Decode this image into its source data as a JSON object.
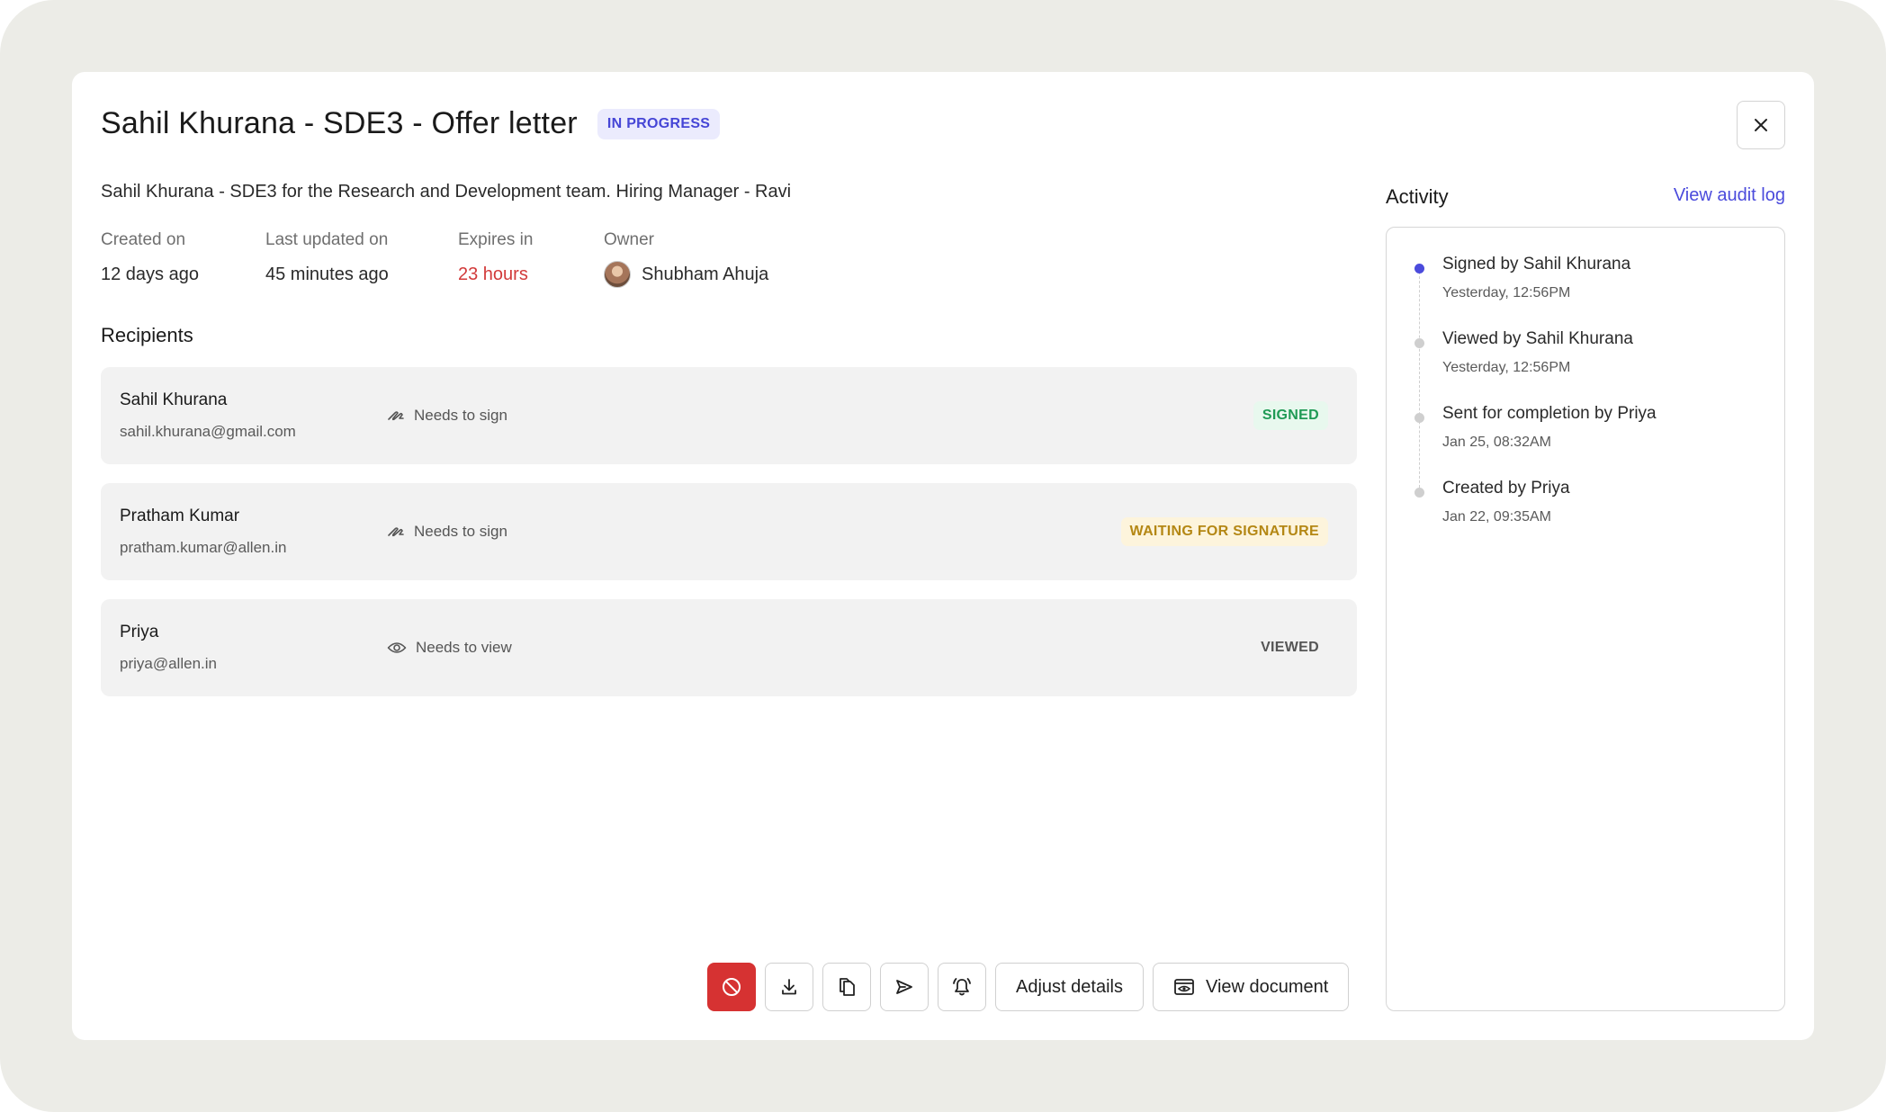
{
  "header": {
    "title": "Sahil Khurana - SDE3 - Offer letter",
    "status": "IN PROGRESS",
    "description": "Sahil Khurana - SDE3 for the Research and Development team. Hiring Manager - Ravi"
  },
  "meta": {
    "created_label": "Created on",
    "created_value": "12 days ago",
    "updated_label": "Last updated on",
    "updated_value": "45 minutes ago",
    "expires_label": "Expires in",
    "expires_value": "23 hours",
    "owner_label": "Owner",
    "owner_value": "Shubham Ahuja"
  },
  "recipients": {
    "title": "Recipients",
    "items": [
      {
        "name": "Sahil Khurana",
        "email": "sahil.khurana@gmail.com",
        "role": "Needs to sign",
        "role_icon": "signature-icon",
        "status": "SIGNED"
      },
      {
        "name": "Pratham Kumar",
        "email": "pratham.kumar@allen.in",
        "role": "Needs to sign",
        "role_icon": "signature-icon",
        "status": "WAITING FOR SIGNATURE"
      },
      {
        "name": "Priya",
        "email": "priya@allen.in",
        "role": "Needs to view",
        "role_icon": "eye-icon",
        "status": "VIEWED"
      }
    ]
  },
  "activity": {
    "title": "Activity",
    "audit_link": "View audit log",
    "items": [
      {
        "text": "Signed by Sahil Khurana",
        "time": "Yesterday, 12:56PM"
      },
      {
        "text": "Viewed by Sahil Khurana",
        "time": "Yesterday, 12:56PM"
      },
      {
        "text": "Sent for completion by Priya",
        "time": "Jan 25, 08:32AM"
      },
      {
        "text": "Created by Priya",
        "time": "Jan 22, 09:35AM"
      }
    ]
  },
  "toolbar": {
    "adjust_label": "Adjust details",
    "view_label": "View document"
  },
  "colors": {
    "accent": "#4b4bdc",
    "danger": "#d63232",
    "expires": "#d23a3a",
    "signed": "#1f9a55",
    "waiting": "#b48714"
  }
}
